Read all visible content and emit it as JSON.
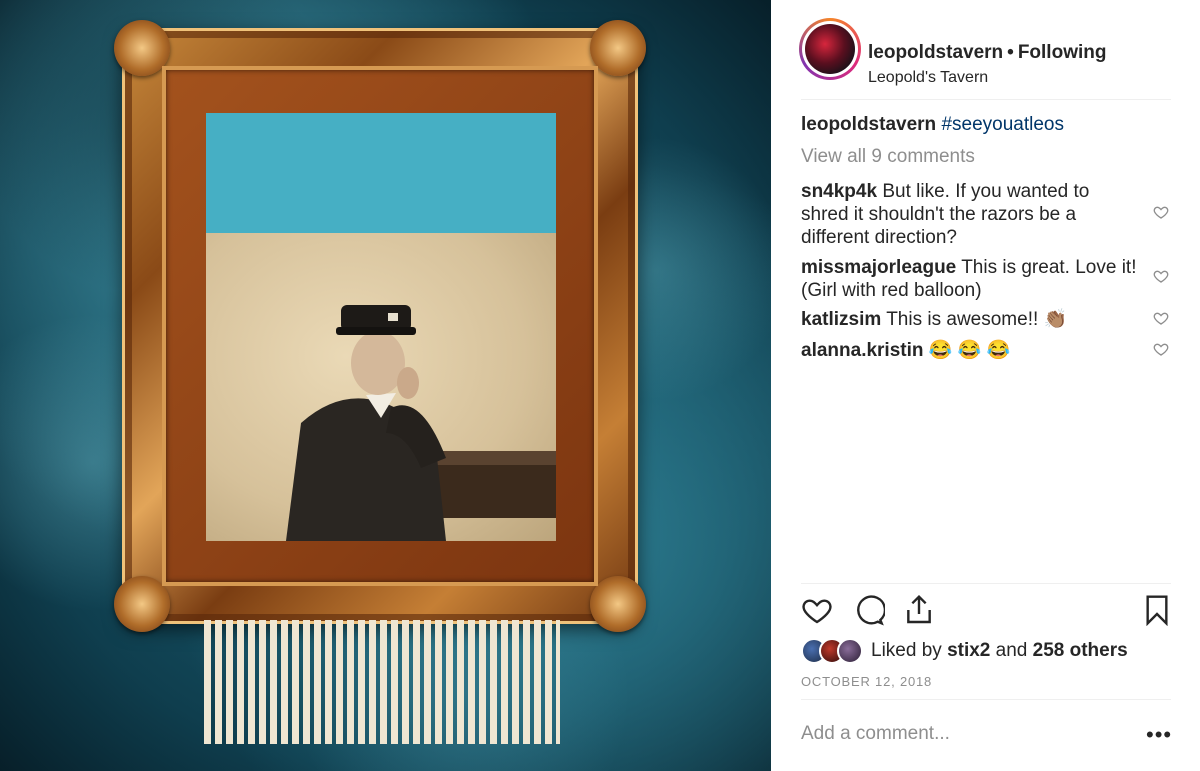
{
  "post": {
    "image_icon": "framed-vintage-portrait-shredded",
    "accent_colors": {
      "teal_background": "#1f6b80",
      "frame_gold": "#c98a3c",
      "mat_teal": "#46afc4"
    }
  },
  "header": {
    "username": "leopoldstavern",
    "separator": "•",
    "follow_status": "Following",
    "location": "Leopold's Tavern"
  },
  "caption": {
    "username": "leopoldstavern",
    "hashtag": "#seeyouatleos"
  },
  "view_all_comments": "View all 9 comments",
  "comments": [
    {
      "username": "sn4kp4k",
      "text": "But like. If you wanted to shred it shouldn't the razors be a different direction?"
    },
    {
      "username": "missmajorleague",
      "text": "This is great. Love it! (Girl with red balloon)"
    },
    {
      "username": "katlizsim",
      "text": "This is awesome!! 👏🏽"
    },
    {
      "username": "alanna.kristin",
      "text": "😂 😂 😂"
    }
  ],
  "actions": {
    "like_icon": "heart-icon",
    "comment_icon": "comment-icon",
    "share_icon": "share-icon",
    "save_icon": "bookmark-icon"
  },
  "likes": {
    "prefix": "Liked by",
    "user": "stix2",
    "conjunction": "and",
    "others": "258 others"
  },
  "date": "OCTOBER 12, 2018",
  "add_comment_placeholder": "Add a comment...",
  "more_label": "•••"
}
